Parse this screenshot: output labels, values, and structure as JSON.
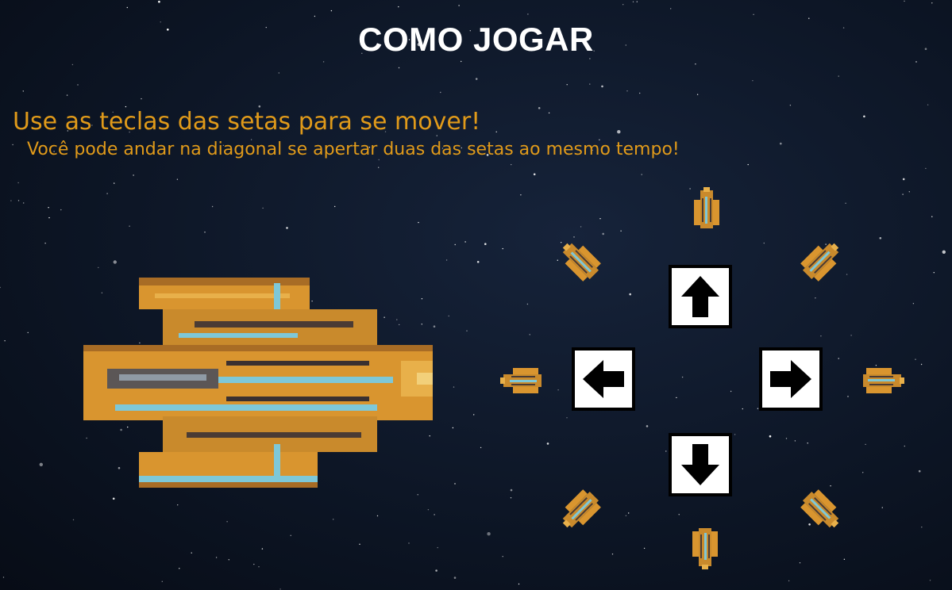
{
  "screen": {
    "title": "COMO JOGAR",
    "instruction_main": "Use as teclas das setas para se mover!",
    "instruction_sub": "Você pode andar na diagonal se apertar duas das setas ao mesmo tempo!"
  },
  "colors": {
    "background": "#0d1626",
    "title": "#ffffff",
    "instruction": "#e09a1a",
    "ship_gold": "#d9952f",
    "ship_cyan": "#7ec8d8",
    "ship_dark": "#3a3030"
  },
  "keys": [
    {
      "name": "up",
      "icon": "arrow-up-icon"
    },
    {
      "name": "left",
      "icon": "arrow-left-icon"
    },
    {
      "name": "right",
      "icon": "arrow-right-icon"
    },
    {
      "name": "down",
      "icon": "arrow-down-icon"
    }
  ],
  "ships": {
    "player": "spaceship-icon",
    "directions": [
      "up",
      "up-right",
      "right",
      "down-right",
      "down",
      "down-left",
      "left",
      "up-left"
    ]
  }
}
